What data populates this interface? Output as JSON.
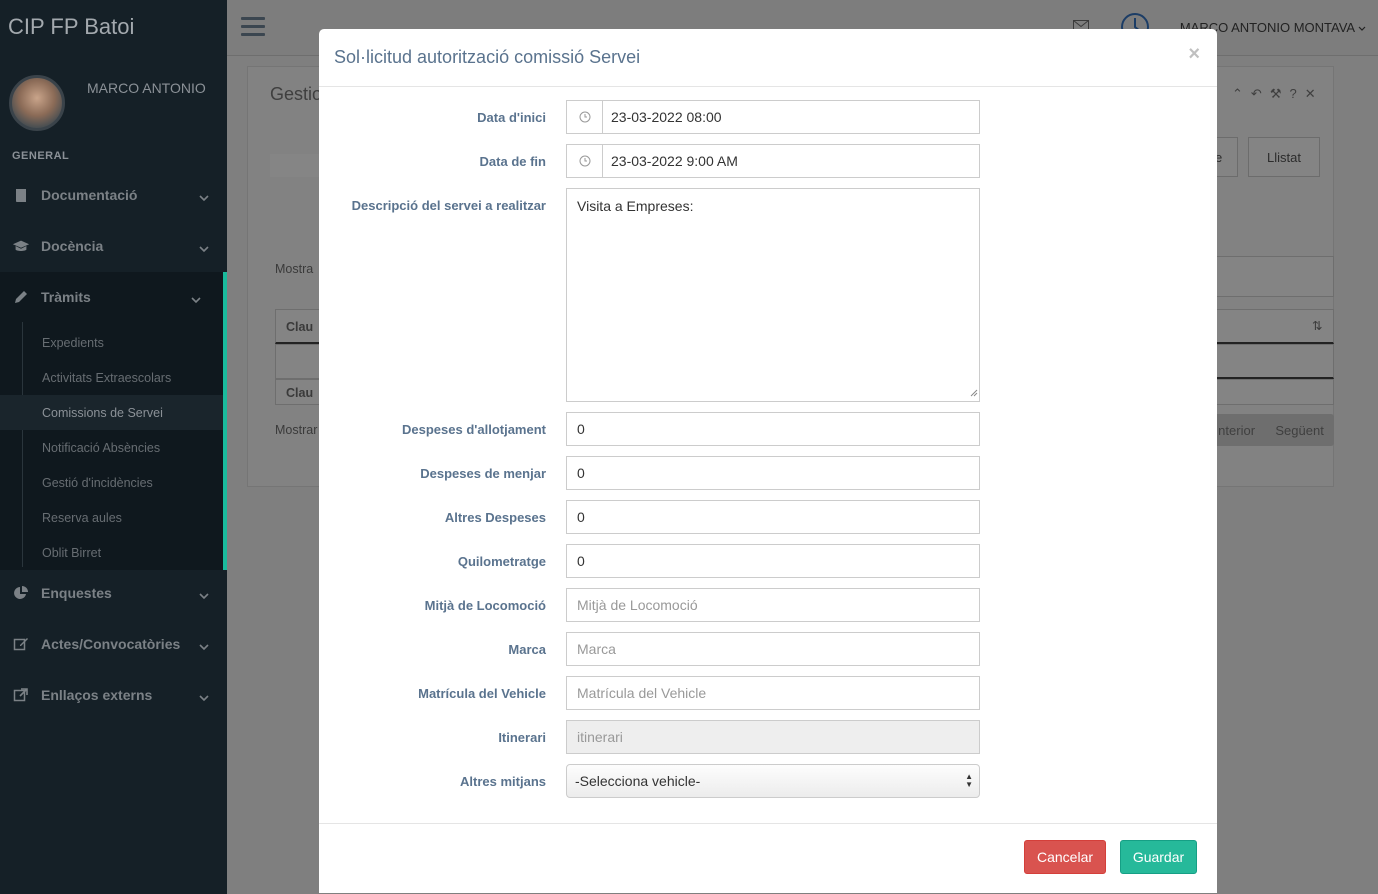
{
  "app": {
    "brand": "CIP FP Batoi"
  },
  "sidebar": {
    "user_name": "MARCO ANTONIO",
    "section": "GENERAL",
    "menu": [
      {
        "label": "Documentació",
        "icon": "book-icon"
      },
      {
        "label": "Docència",
        "icon": "graduation-cap-icon"
      },
      {
        "label": "Tràmits",
        "icon": "pencil-icon"
      },
      {
        "label": "Enquestes",
        "icon": "pie-chart-icon"
      },
      {
        "label": "Actes/Convocatòries",
        "icon": "edit-icon"
      },
      {
        "label": "Enllaços externs",
        "icon": "external-link-icon"
      }
    ],
    "submenu": [
      "Expedients",
      "Activitats Extraescolars",
      "Comissions de Servei",
      "Notificació Absències",
      "Gestió d'incidències",
      "Reserva aules",
      "Oblit Birret"
    ]
  },
  "topbar": {
    "user": "MARCO ANTONIO MONTAVA"
  },
  "background": {
    "title": "Gestio",
    "tab_visible_fragment": "e",
    "tab_list": "Llistat",
    "show_label_1": "Mostra",
    "col_key_1": "Clau",
    "col_key_2": "Clau",
    "show_label_2": "Mostrar",
    "pager_prev": "nterior",
    "pager_next": "Següent"
  },
  "modal": {
    "title": "Sol·licitud autorització comissió Servei",
    "close": "×",
    "fields": {
      "start_date_label": "Data d'inici",
      "start_date_value": "23-03-2022 08:00",
      "end_date_label": "Data de fin",
      "end_date_value": "23-03-2022 9:00 AM",
      "description_label": "Descripció del servei a realitzar",
      "description_value": "Visita a Empreses:",
      "lodging_label": "Despeses d'allotjament",
      "lodging_value": "0",
      "food_label": "Despeses de menjar",
      "food_value": "0",
      "other_label": "Altres Despeses",
      "other_value": "0",
      "mileage_label": "Quilometratge",
      "mileage_value": "0",
      "transport_label": "Mitjà de Locomoció",
      "transport_placeholder": "Mitjà de Locomoció",
      "brand_label": "Marca",
      "brand_placeholder": "Marca",
      "plate_label": "Matrícula del Vehicle",
      "plate_placeholder": "Matrícula del Vehicle",
      "itinerary_label": "Itinerari",
      "itinerary_placeholder": "itinerari",
      "other_means_label": "Altres mitjans",
      "other_means_selected": "-Selecciona vehicle-"
    },
    "buttons": {
      "cancel": "Cancelar",
      "save": "Guardar"
    }
  },
  "colors": {
    "accent": "#1abb9c",
    "danger": "#d9534f",
    "success": "#26b99a",
    "sidebar": "#152027",
    "label": "#5a738e"
  }
}
